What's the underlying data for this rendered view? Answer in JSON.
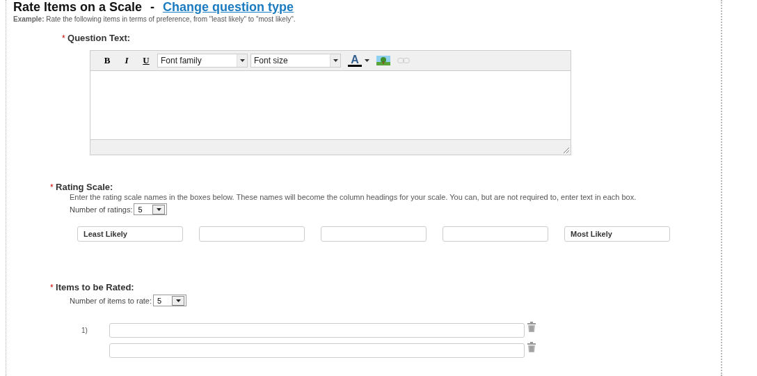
{
  "header": {
    "title": "Rate Items on a Scale",
    "separator": "-",
    "link": "Change question type",
    "example": "**Example:** Rate the following items in terms of preference, from \"least likely\" to \"most likely\"."
  },
  "question_text": {
    "marker": "*",
    "label": "Question Text:",
    "toolbar": {
      "bold": "B",
      "italic": "I",
      "underline": "U",
      "font_family": "Font family",
      "font_size": "Font size",
      "color_letter": "A"
    }
  },
  "rating_scale": {
    "marker": "*",
    "label": "Rating Scale:",
    "description": "Enter the rating scale names in the boxes below. These names will become the column headings for your scale. You can, but are not required to, enter text in each box.",
    "count_label": "Number of ratings:",
    "count": "5",
    "first_name": "Least Likely",
    "last_name": "Most Likely"
  },
  "items_to_rate": {
    "marker": "*",
    "label": "Items to be Rated:",
    "count_label": "Number of items to rate:",
    "count": "5",
    "items": [
      {
        "number": "1)"
      }
    ],
    "more_rows_below": true
  }
}
